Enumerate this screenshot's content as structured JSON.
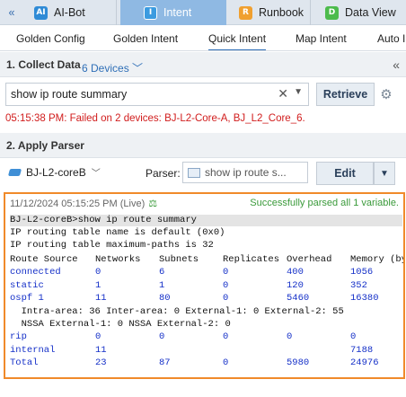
{
  "app_tabs": [
    {
      "label": "AI-Bot",
      "icon_letter": "AI",
      "icon_color": "#2f8bd6"
    },
    {
      "label": "Intent",
      "icon_letter": "I",
      "icon_color": "#3b9be0"
    },
    {
      "label": "Runbook",
      "icon_letter": "R",
      "icon_color": "#f0a030"
    },
    {
      "label": "Data View",
      "icon_letter": "D",
      "icon_color": "#4cbb4c"
    }
  ],
  "sub_tabs": [
    "Golden Config",
    "Golden Intent",
    "Quick Intent",
    "Map Intent",
    "Auto In"
  ],
  "section1": {
    "title": "1. Collect Data",
    "devices_link": "6 Devices"
  },
  "search": {
    "value": "show ip route summary"
  },
  "retrieve_label": "Retrieve",
  "error_text": "05:15:38 PM: Failed on 2 devices: BJ-L2-Core-A, BJ_L2_Core_6.",
  "section2": {
    "title": "2. Apply Parser",
    "device": "BJ-L2-coreB",
    "parser_label": "Parser:",
    "parser_value": "show ip route s...",
    "edit_label": "Edit"
  },
  "result": {
    "timestamp": "11/12/2024 05:15:25 PM (Live)",
    "status": "Successfully parsed all 1 variable.",
    "command_line": "BJ-L2-coreB>show ip route summary",
    "lines": [
      "IP routing table name is default (0x0)",
      "IP routing table maximum-paths is 32"
    ],
    "table_header": [
      "Route Source",
      "Networks",
      "Subnets",
      "Replicates",
      "Overhead",
      "Memory (by"
    ],
    "rows": [
      {
        "cells": [
          "connected",
          "0",
          "6",
          "0",
          "400",
          "1056"
        ]
      },
      {
        "cells": [
          "static",
          "1",
          "1",
          "0",
          "120",
          "352"
        ]
      },
      {
        "cells": [
          "ospf 1",
          "11",
          "80",
          "0",
          "5460",
          "16380"
        ]
      }
    ],
    "ospf_detail": [
      "  Intra-area: 36 Inter-area: 0 External-1: 0 External-2: 55",
      "  NSSA External-1: 0 NSSA External-2: 0"
    ],
    "rows2": [
      {
        "cells": [
          "rip",
          "0",
          "0",
          "0",
          "0",
          "0"
        ]
      },
      {
        "cells": [
          "internal",
          "11",
          "",
          "",
          "",
          "7188"
        ]
      },
      {
        "cells": [
          "Total",
          "23",
          "87",
          "0",
          "5980",
          "24976"
        ]
      }
    ]
  },
  "colors": {
    "accent": "#2f6fb7",
    "error": "#d11c1c",
    "success": "#3a9a3a",
    "highlight_border": "#f08a2a",
    "value_blue": "#1530c8"
  }
}
